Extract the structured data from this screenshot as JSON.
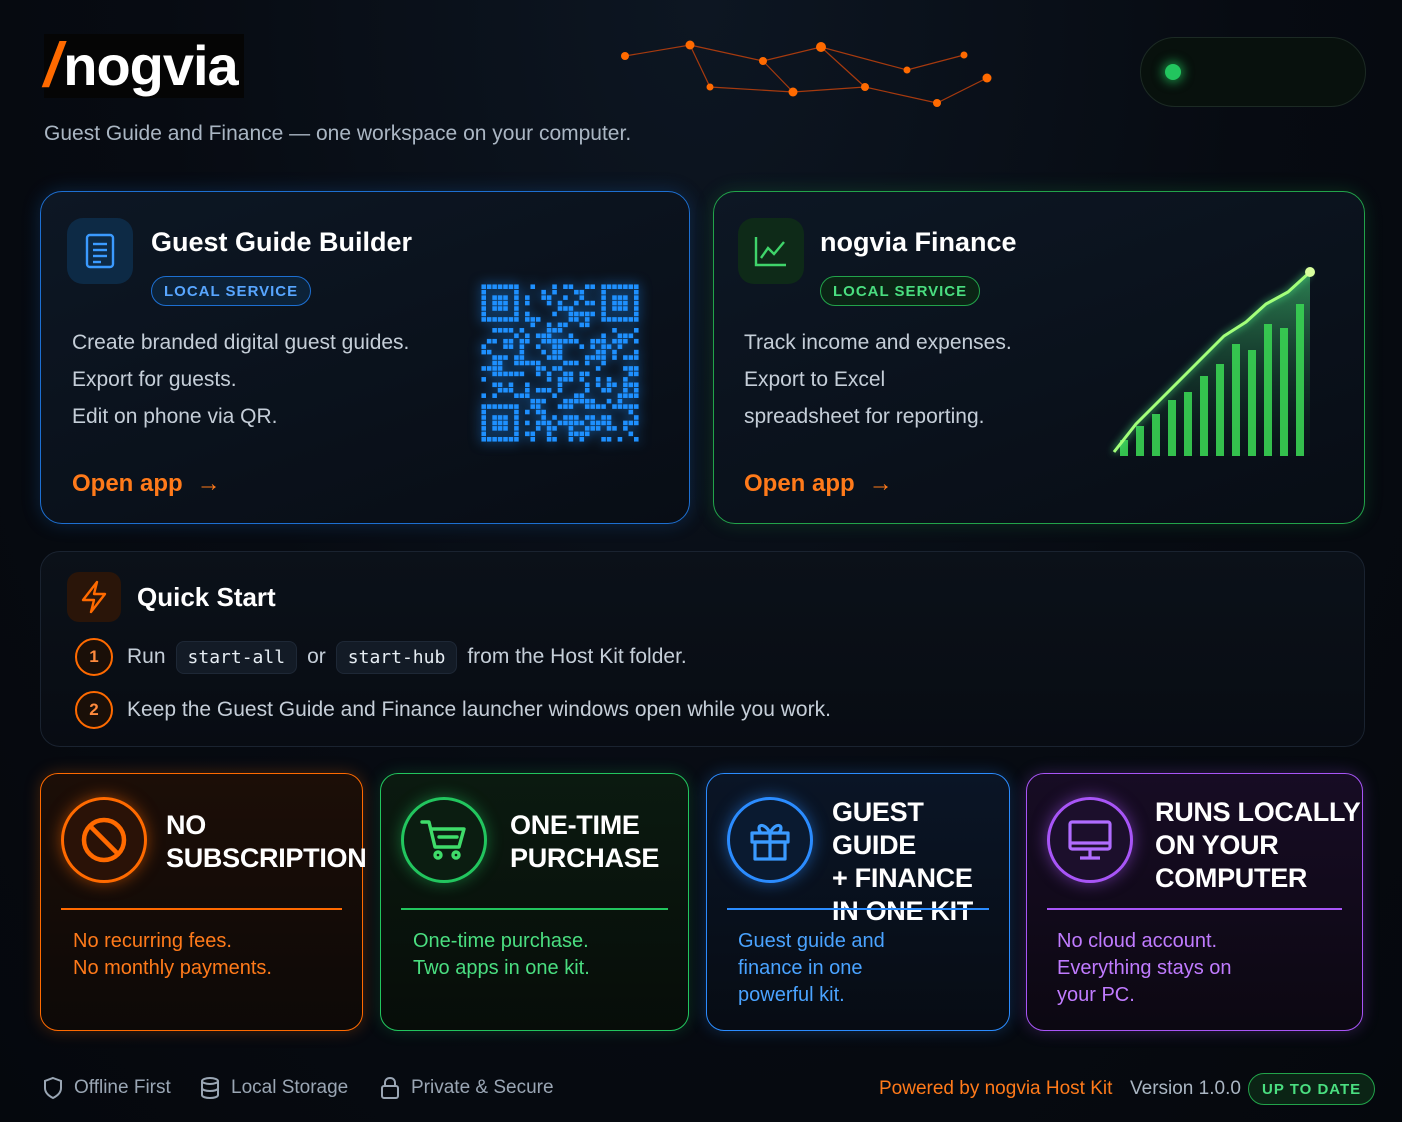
{
  "header": {
    "logo_slash": "/",
    "logo_word": "nogvia",
    "tagline": "Guest Guide and Finance — one workspace on your computer."
  },
  "status": {
    "indicator": "online",
    "color": "#22c55e"
  },
  "apps": [
    {
      "title": "Guest Guide Builder",
      "badge": "LOCAL SERVICE",
      "icon": "document-icon",
      "description": [
        "Create branded digital guest guides.",
        "Export for guests.",
        "Edit on phone via QR."
      ],
      "action": "Open app",
      "action_arrow": "→",
      "accent": "#1d6fd1"
    },
    {
      "title": "nogvia Finance",
      "badge": "LOCAL SERVICE",
      "icon": "chart-line-icon",
      "description": [
        "Track income and expenses.",
        "Export to Excel",
        "spreadsheet for reporting."
      ],
      "action": "Open app",
      "action_arrow": "→",
      "accent": "#22a34a"
    }
  ],
  "quick_start": {
    "title": "Quick Start",
    "icon": "lightning-icon",
    "steps": [
      {
        "num": "1",
        "pre": "Run",
        "code1": "start-all",
        "mid": "or",
        "code2": "start-hub",
        "post": "from the Host Kit folder."
      },
      {
        "num": "2",
        "text": "Keep the Guest Guide and Finance launcher windows open while you work."
      }
    ]
  },
  "features": [
    {
      "title": [
        "NO",
        "SUBSCRIPTION"
      ],
      "desc": [
        "No recurring fees.",
        "No monthly payments."
      ],
      "icon": "no-entry-icon",
      "color": "#ff6a00"
    },
    {
      "title": [
        "ONE-TIME",
        "PURCHASE"
      ],
      "desc": [
        "One-time purchase.",
        "Two apps in one kit."
      ],
      "icon": "cart-icon",
      "color": "#22c55e"
    },
    {
      "title": [
        "GUEST GUIDE",
        "+ FINANCE",
        "IN ONE KIT"
      ],
      "desc": [
        "Guest guide and",
        "finance in one",
        "powerful kit."
      ],
      "icon": "gift-icon",
      "color": "#2b8cff"
    },
    {
      "title": [
        "RUNS LOCALLY",
        "ON YOUR",
        "COMPUTER"
      ],
      "desc": [
        "No cloud account.",
        "Everything stays on",
        "your PC."
      ],
      "icon": "monitor-icon",
      "color": "#a855f7"
    }
  ],
  "footer": {
    "items": [
      {
        "label": "Offline First",
        "icon": "shield-icon"
      },
      {
        "label": "Local Storage",
        "icon": "database-icon"
      },
      {
        "label": "Private & Secure",
        "icon": "lock-icon"
      }
    ],
    "powered": "Powered by nogvia Host Kit",
    "version": "Version 1.0.0",
    "status_badge": "UP TO DATE"
  }
}
